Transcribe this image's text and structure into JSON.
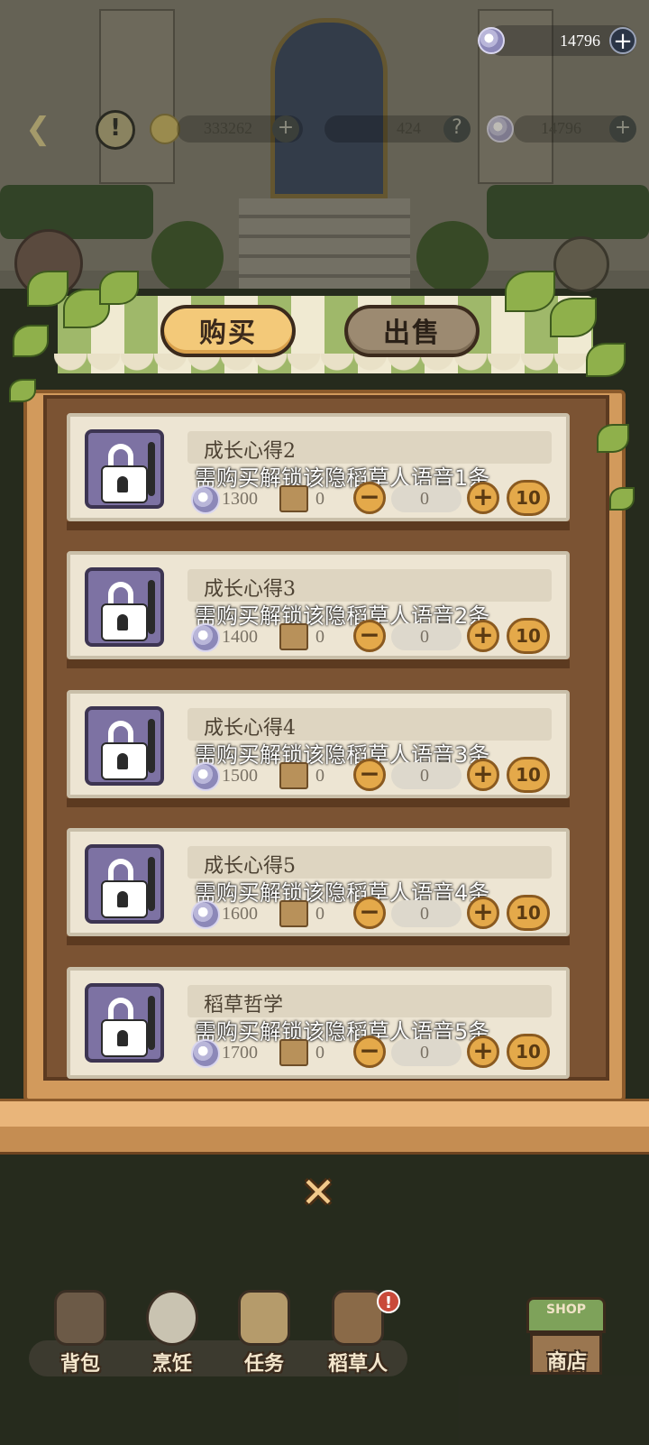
{
  "top_bar": {
    "currency_amount": "14796",
    "plus_label": "+"
  },
  "hud": {
    "gold_amount": "333262",
    "gem_amount": "424",
    "currency_amount": "14796",
    "plus_label": "+",
    "help_label": "?",
    "warn_label": "!"
  },
  "tabs": {
    "buy": "购买",
    "sell": "出售",
    "active": "buy"
  },
  "items": [
    {
      "name": "成长心得2",
      "desc": "需购买解锁该隐稻草人语音1条",
      "price": "1300",
      "owned": "0",
      "qty": "0",
      "ten": "10",
      "minus": "−",
      "plus": "+"
    },
    {
      "name": "成长心得3",
      "desc": "需购买解锁该隐稻草人语音2条",
      "price": "1400",
      "owned": "0",
      "qty": "0",
      "ten": "10",
      "minus": "−",
      "plus": "+"
    },
    {
      "name": "成长心得4",
      "desc": "需购买解锁该隐稻草人语音3条",
      "price": "1500",
      "owned": "0",
      "qty": "0",
      "ten": "10",
      "minus": "−",
      "plus": "+"
    },
    {
      "name": "成长心得5",
      "desc": "需购买解锁该隐稻草人语音4条",
      "price": "1600",
      "owned": "0",
      "qty": "0",
      "ten": "10",
      "minus": "−",
      "plus": "+"
    },
    {
      "name": "稻草哲学",
      "desc": "需购买解锁该隐稻草人语音5条",
      "price": "1700",
      "owned": "0",
      "qty": "0",
      "ten": "10",
      "minus": "−",
      "plus": "+"
    }
  ],
  "close_label": "✕",
  "bottom_nav": [
    {
      "label": "背包",
      "icon": "backpack-icon"
    },
    {
      "label": "烹饪",
      "icon": "cooking-icon"
    },
    {
      "label": "任务",
      "icon": "quest-icon"
    },
    {
      "label": "稻草人",
      "icon": "scarecrow-icon"
    }
  ],
  "nav_badge": "!",
  "shop": {
    "roof_label": "SHOP",
    "label": "商店"
  },
  "colors": {
    "accent": "#f3c979",
    "frame": "#d29a5c",
    "item_bg": "#ede5d3",
    "button": "#e4a94a"
  }
}
